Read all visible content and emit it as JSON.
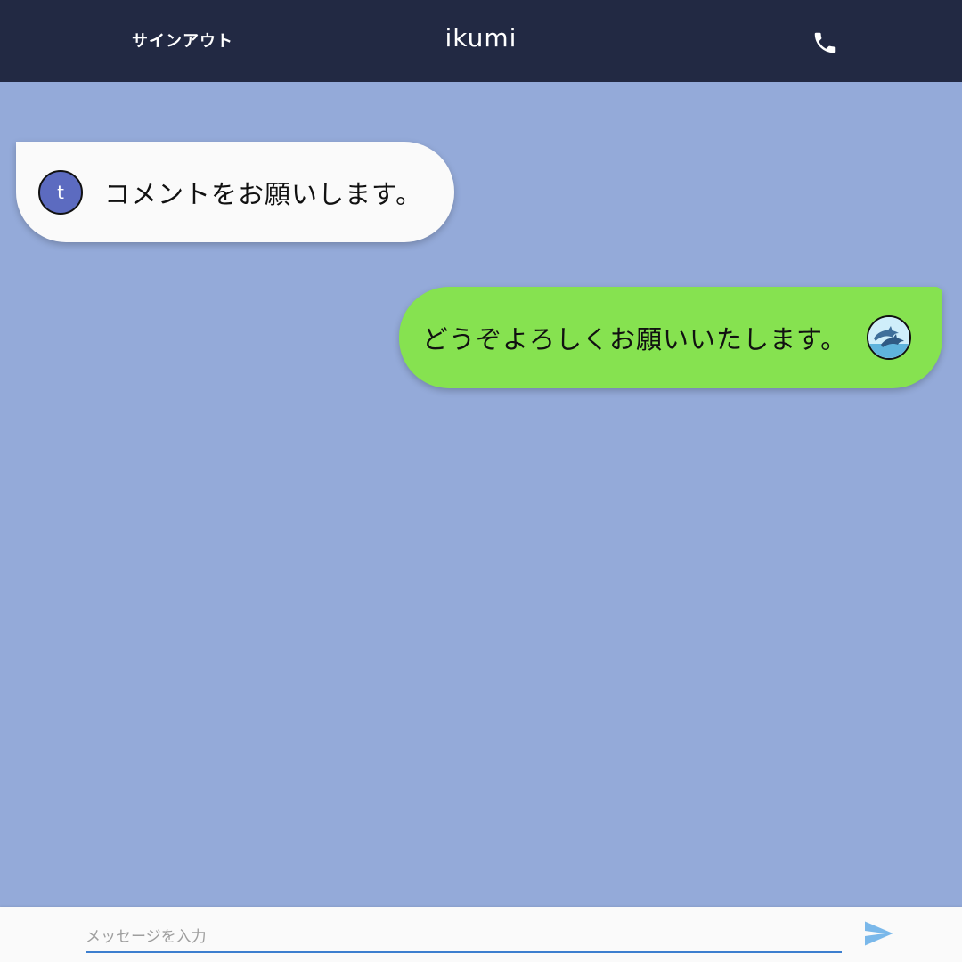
{
  "header": {
    "signout_label": "サインアウト",
    "title": "ikumi",
    "call_icon": "phone-icon"
  },
  "messages": [
    {
      "side": "received",
      "avatar_letter": "t",
      "text": "コメントをお願いします。"
    },
    {
      "side": "sent",
      "avatar_icon": "dolphin-avatar",
      "text": "どうぞよろしくお願いいたします。"
    }
  ],
  "composer": {
    "placeholder": "メッセージを入力",
    "value": "",
    "send_icon": "send-icon"
  },
  "colors": {
    "appbar": "#222943",
    "chat_background": "#94aad9",
    "received_bubble": "#fafafa",
    "sent_bubble": "#86e250",
    "avatar_letter_bg": "#5c6bc0",
    "accent": "#3d7fcf"
  }
}
